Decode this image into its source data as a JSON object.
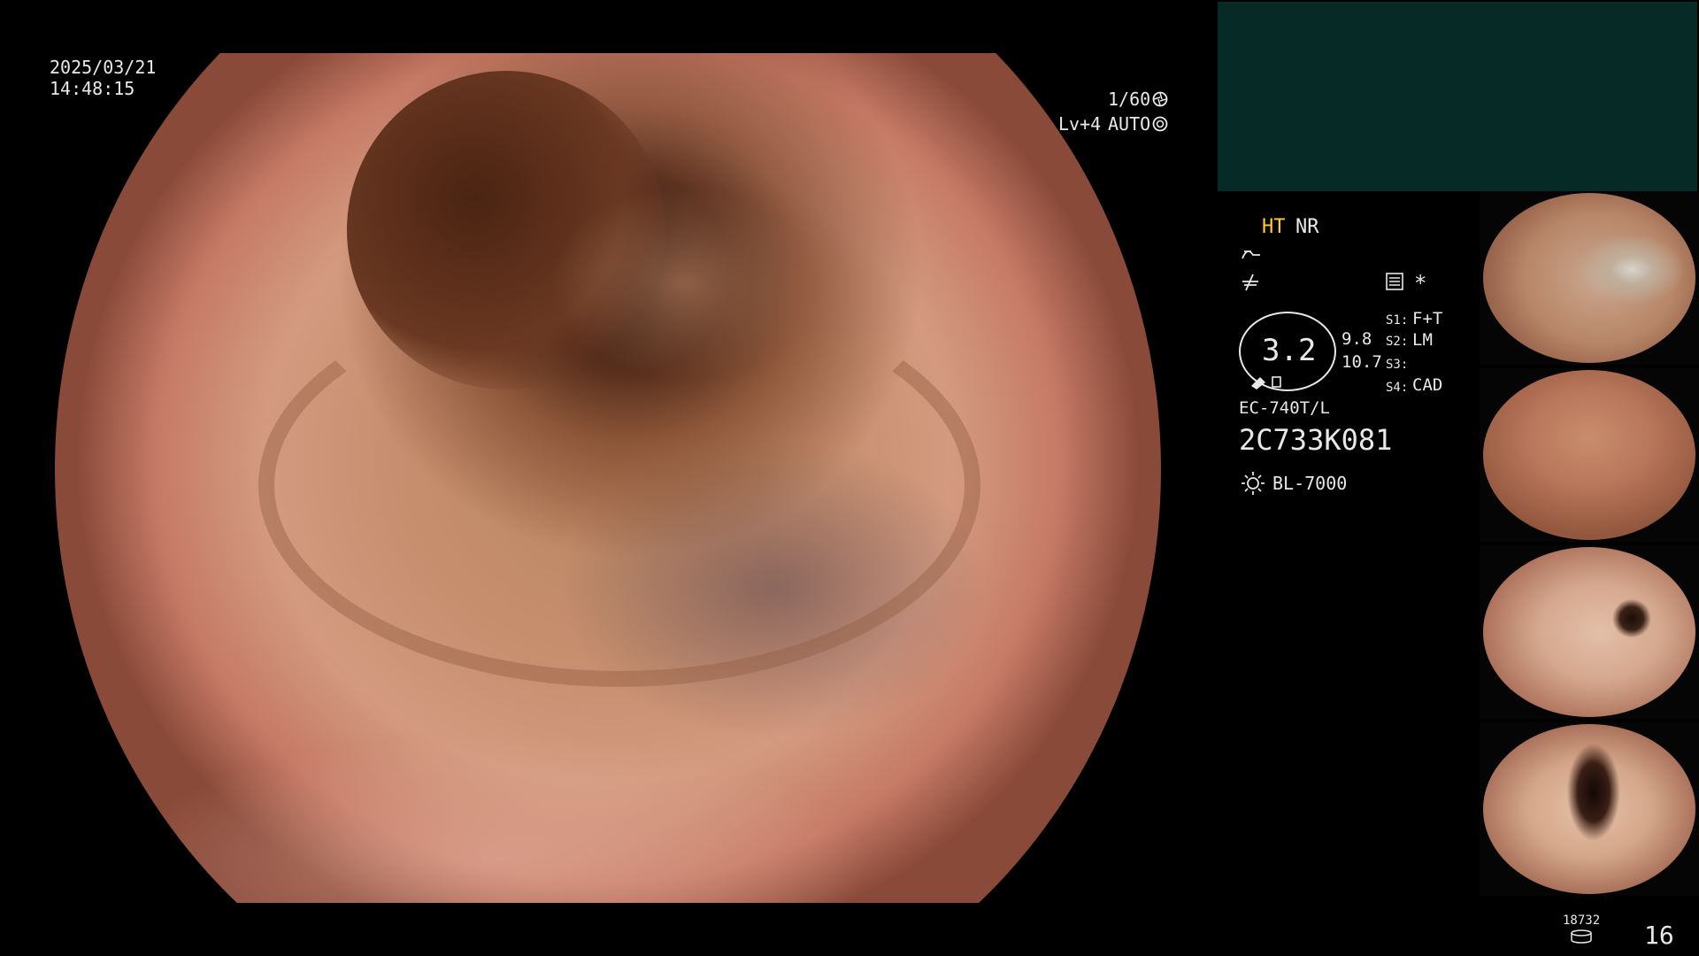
{
  "overlay": {
    "date": "2025/03/21",
    "time": "14:48:15",
    "shutter": "1/60",
    "level": "Lv+4",
    "mode": "AUTO"
  },
  "status": {
    "ht": "HT",
    "nr": "NR",
    "zoom_value": "3.2",
    "value_a": "9.8",
    "value_b": "10.7",
    "s1_key": "S1:",
    "s1_val": "F+T",
    "s2_key": "S2:",
    "s2_val": "LM",
    "s3_key": "S3:",
    "s3_val": "",
    "s4_key": "S4:",
    "s4_val": "CAD",
    "scope_model": "EC-740T/L",
    "serial": "2C733K081",
    "light_source": "BL-7000",
    "star": "*"
  },
  "footer": {
    "counter": "18732",
    "image_count": "16"
  },
  "icons": {
    "shutter": "aperture-icon",
    "mode": "target-icon",
    "tone": "tone-curve-icon",
    "enhance": "enhance-icon",
    "menu": "menu-icon",
    "light": "sun-icon",
    "storage": "database-icon"
  }
}
